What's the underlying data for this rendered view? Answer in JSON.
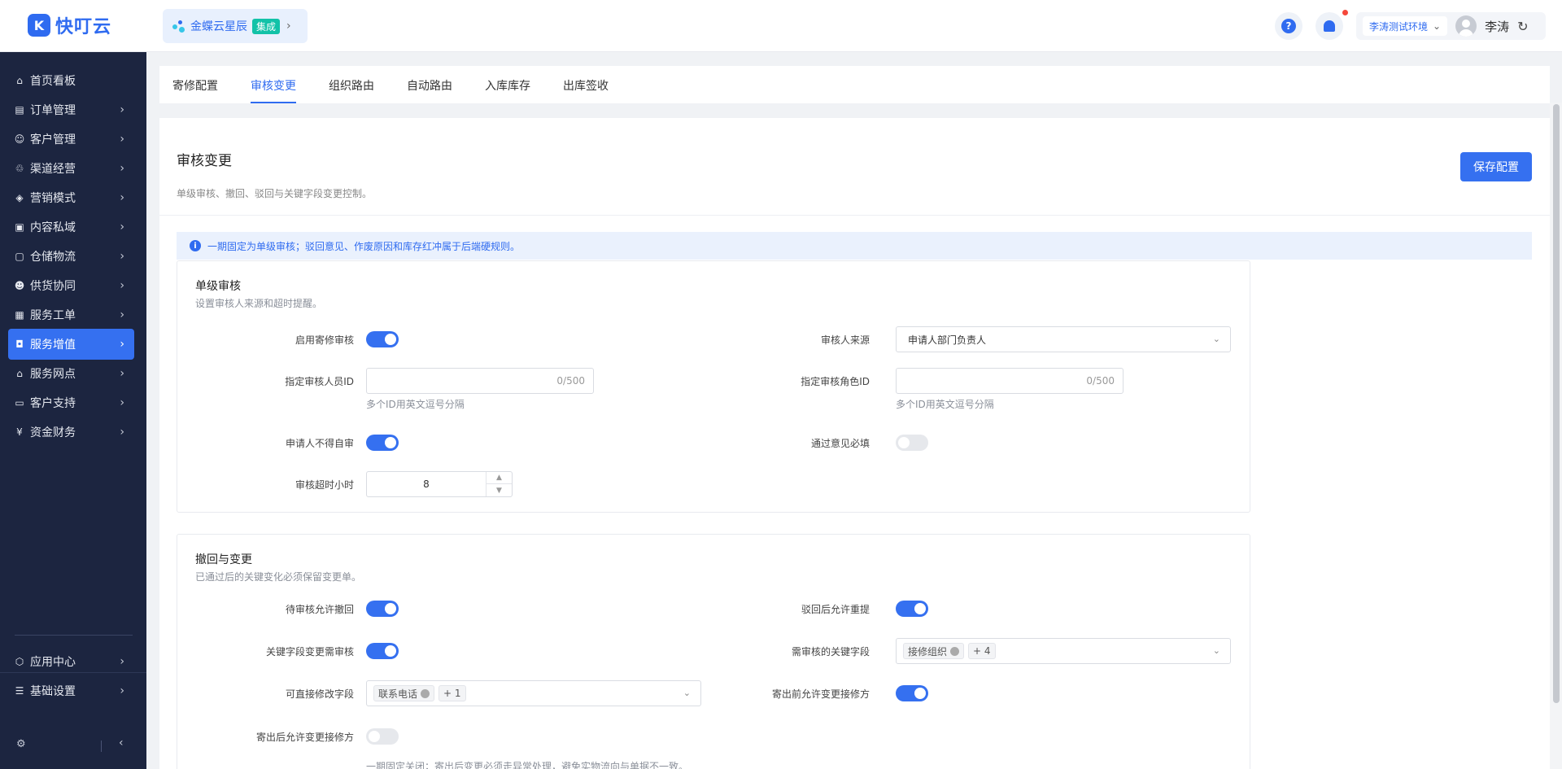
{
  "app": {
    "logo_text": "快叮云",
    "logo_mark": "K",
    "tenant_name": "金蝶云星辰",
    "tenant_badge": "集成",
    "help_symbol": "?",
    "env": "李涛测试环境",
    "user_name": "李涛"
  },
  "sidebar": {
    "items": [
      {
        "label": "首页看板",
        "icon": "home-icon"
      },
      {
        "label": "订单管理",
        "icon": "order-icon"
      },
      {
        "label": "客户管理",
        "icon": "user-icon"
      },
      {
        "label": "渠道经营",
        "icon": "channel-icon"
      },
      {
        "label": "营销模式",
        "icon": "tag-icon"
      },
      {
        "label": "内容私域",
        "icon": "image-icon"
      },
      {
        "label": "仓储物流",
        "icon": "warehouse-icon"
      },
      {
        "label": "供货协同",
        "icon": "supply-icon"
      },
      {
        "label": "服务工单",
        "icon": "ticket-icon"
      },
      {
        "label": "服务增值",
        "icon": "bag-icon",
        "active": true
      },
      {
        "label": "服务网点",
        "icon": "store-icon"
      },
      {
        "label": "客户支持",
        "icon": "support-icon"
      },
      {
        "label": "资金财务",
        "icon": "yen-icon"
      }
    ],
    "bottom_items": [
      {
        "label": "应用中心",
        "icon": "cube-icon"
      },
      {
        "label": "基础设置",
        "icon": "settings-list-icon"
      }
    ]
  },
  "tabs": [
    "寄修配置",
    "审核变更",
    "组织路由",
    "自动路由",
    "入库库存",
    "出库签收"
  ],
  "active_tab": "审核变更",
  "page": {
    "title": "审核变更",
    "subtitle": "单级审核、撤回、驳回与关键字段变更控制。",
    "save_label": "保存配置",
    "info": "一期固定为单级审核；驳回意见、作废原因和库存红冲属于后端硬规则。"
  },
  "section1": {
    "title": "单级审核",
    "subtitle": "设置审核人来源和超时提醒。",
    "enable_label": "启用寄修审核",
    "enable_on": true,
    "source_label": "审核人来源",
    "source_value": "申请人部门负责人",
    "reviewer_ids_label": "指定审核人员ID",
    "reviewer_ids_counter": "0/500",
    "reviewer_ids_help": "多个ID用英文逗号分隔",
    "role_ids_label": "指定审核角色ID",
    "role_ids_counter": "0/500",
    "role_ids_help": "多个ID用英文逗号分隔",
    "no_self_label": "申请人不得自审",
    "no_self_on": true,
    "opinion_label": "通过意见必填",
    "opinion_on": false,
    "timeout_label": "审核超时小时",
    "timeout_value": "8"
  },
  "section2": {
    "title": "撤回与变更",
    "subtitle": "已通过后的关键变化必须保留变更单。",
    "allow_withdraw_label": "待审核允许撤回",
    "allow_withdraw_on": true,
    "resubmit_label": "驳回后允许重提",
    "resubmit_on": true,
    "key_review_label": "关键字段变更需审核",
    "key_review_on": true,
    "key_fields_label": "需审核的关键字段",
    "key_fields_tag": "接修组织",
    "key_fields_more": "+ 4",
    "direct_fields_label": "可直接修改字段",
    "direct_fields_tag": "联系电话",
    "direct_fields_more": "+ 1",
    "before_ship_label": "寄出前允许变更接修方",
    "before_ship_on": true,
    "after_ship_label": "寄出后允许变更接修方",
    "after_ship_on": false,
    "after_ship_help": "一期固定关闭；寄出后变更必须走异常处理，避免实物流向与单据不一致。"
  }
}
